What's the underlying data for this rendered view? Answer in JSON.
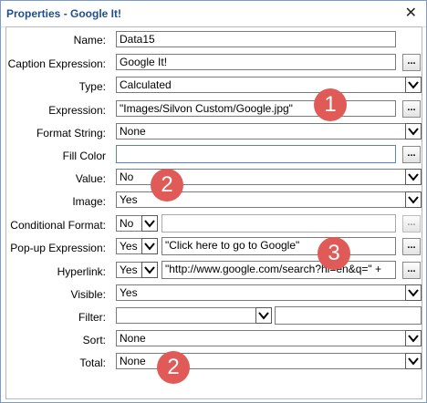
{
  "window": {
    "title": "Properties - Google It!"
  },
  "rows": {
    "name": {
      "label": "Name:",
      "value": "Data15"
    },
    "caption": {
      "label": "Caption Expression:",
      "value": "Google It!"
    },
    "type": {
      "label": "Type:",
      "value": "Calculated"
    },
    "expression": {
      "label": "Expression:",
      "value": "\"Images/Silvon Custom/Google.jpg\""
    },
    "format": {
      "label": "Format String:",
      "value": "None"
    },
    "fill": {
      "label": "Fill Color",
      "value": ""
    },
    "value": {
      "label": "Value:",
      "value": "No"
    },
    "image": {
      "label": "Image:",
      "value": "Yes"
    },
    "conditional": {
      "label": "Conditional Format:",
      "value": "No",
      "text": ""
    },
    "popup": {
      "label": "Pop-up Expression:",
      "value": "Yes",
      "text": "\"Click here to go to Google\""
    },
    "hyperlink": {
      "label": "Hyperlink:",
      "value": "Yes",
      "text": "\"http://www.google.com/search?hl=en&q=\" +"
    },
    "visible": {
      "label": "Visible:",
      "value": "Yes"
    },
    "filter": {
      "label": "Filter:",
      "value": "",
      "text": ""
    },
    "sort": {
      "label": "Sort:",
      "value": "None"
    },
    "total": {
      "label": "Total:",
      "value": "None"
    }
  },
  "buttons": {
    "ellipsis": "..."
  },
  "callouts": {
    "one": "1",
    "two_a": "2",
    "three": "3",
    "two_b": "2"
  },
  "colors": {
    "callout": "#e05a57",
    "title": "#1f4e8c"
  }
}
